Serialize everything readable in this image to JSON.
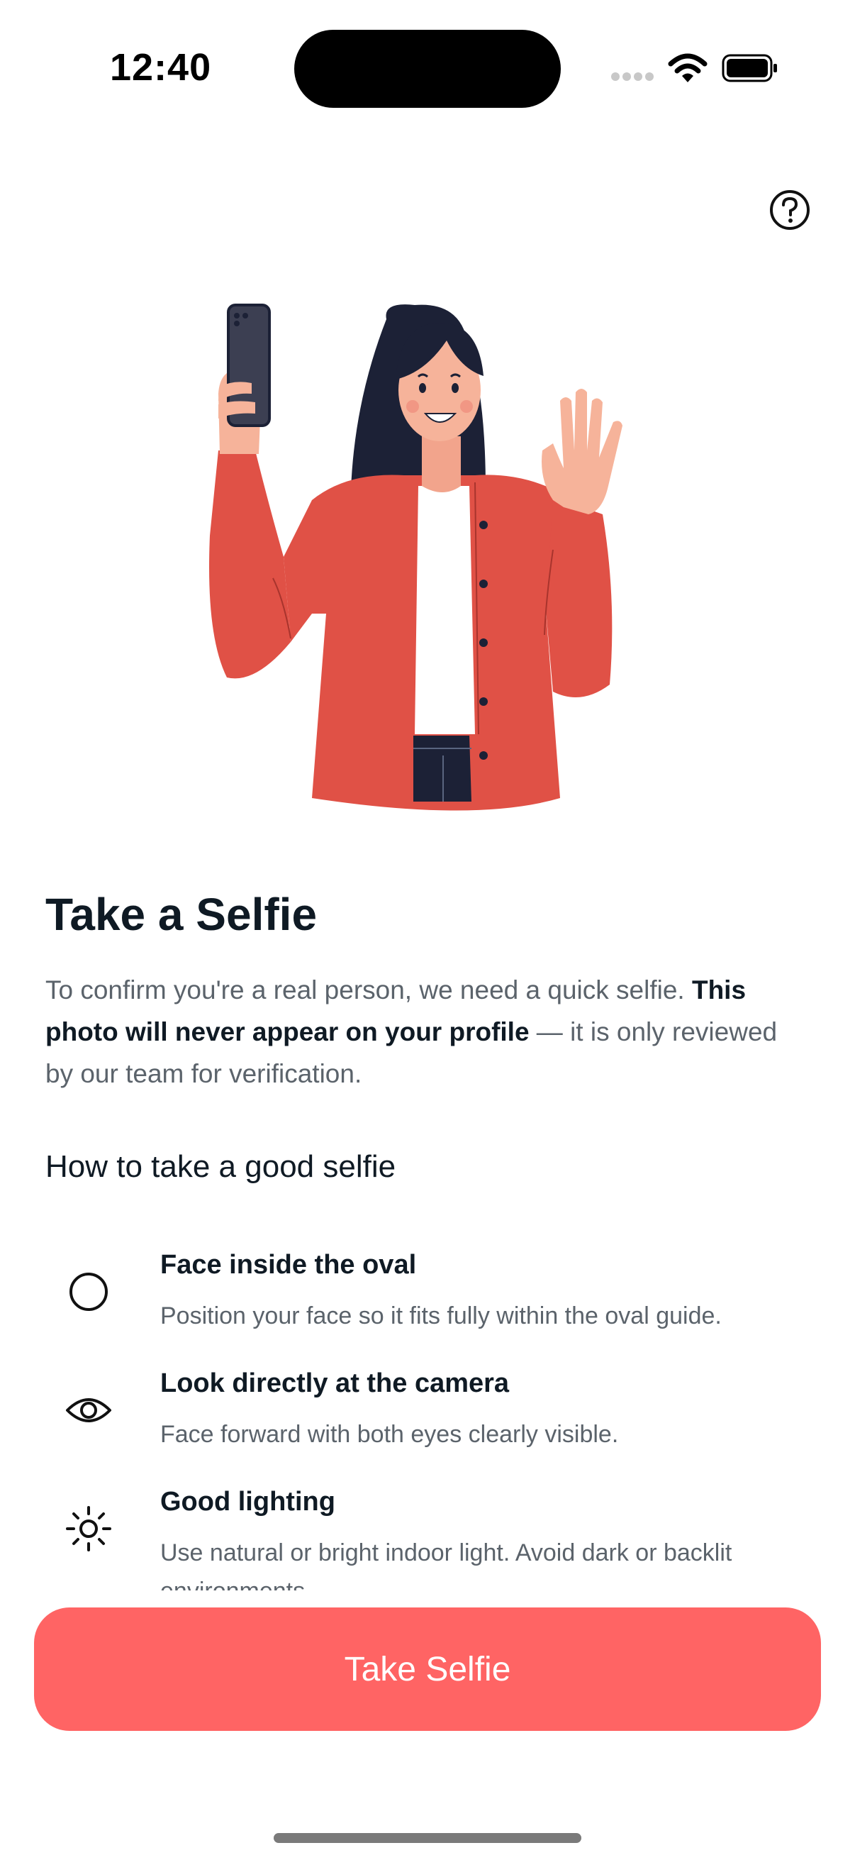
{
  "status_bar": {
    "time": "12:40"
  },
  "icons": {
    "help": "question-circle-icon",
    "tip_1": "circle-outline-icon",
    "tip_2": "eye-icon",
    "tip_3": "sun-icon"
  },
  "content": {
    "title": "Take a Selfie",
    "intro_lead": "To confirm you're a real person, we need a quick selfie.",
    "intro_bold": "This photo will never appear on your profile",
    "intro_tail": " — it is only reviewed by our team for verification.",
    "subhead": "How to take a good selfie"
  },
  "tips": [
    {
      "title": "Face inside the oval",
      "description": "Position your face so it fits fully within the oval guide."
    },
    {
      "title": "Look directly at the camera",
      "description": "Face forward with both eyes clearly visible."
    },
    {
      "title": "Good lighting",
      "description": "Use natural or bright indoor light. Avoid dark or backlit environments."
    }
  ],
  "cta": {
    "label": "Take Selfie"
  },
  "colors": {
    "accent": "#ff6464",
    "heading": "#0f1a24",
    "body_text": "#5b636b",
    "jacket": "#e05146"
  }
}
